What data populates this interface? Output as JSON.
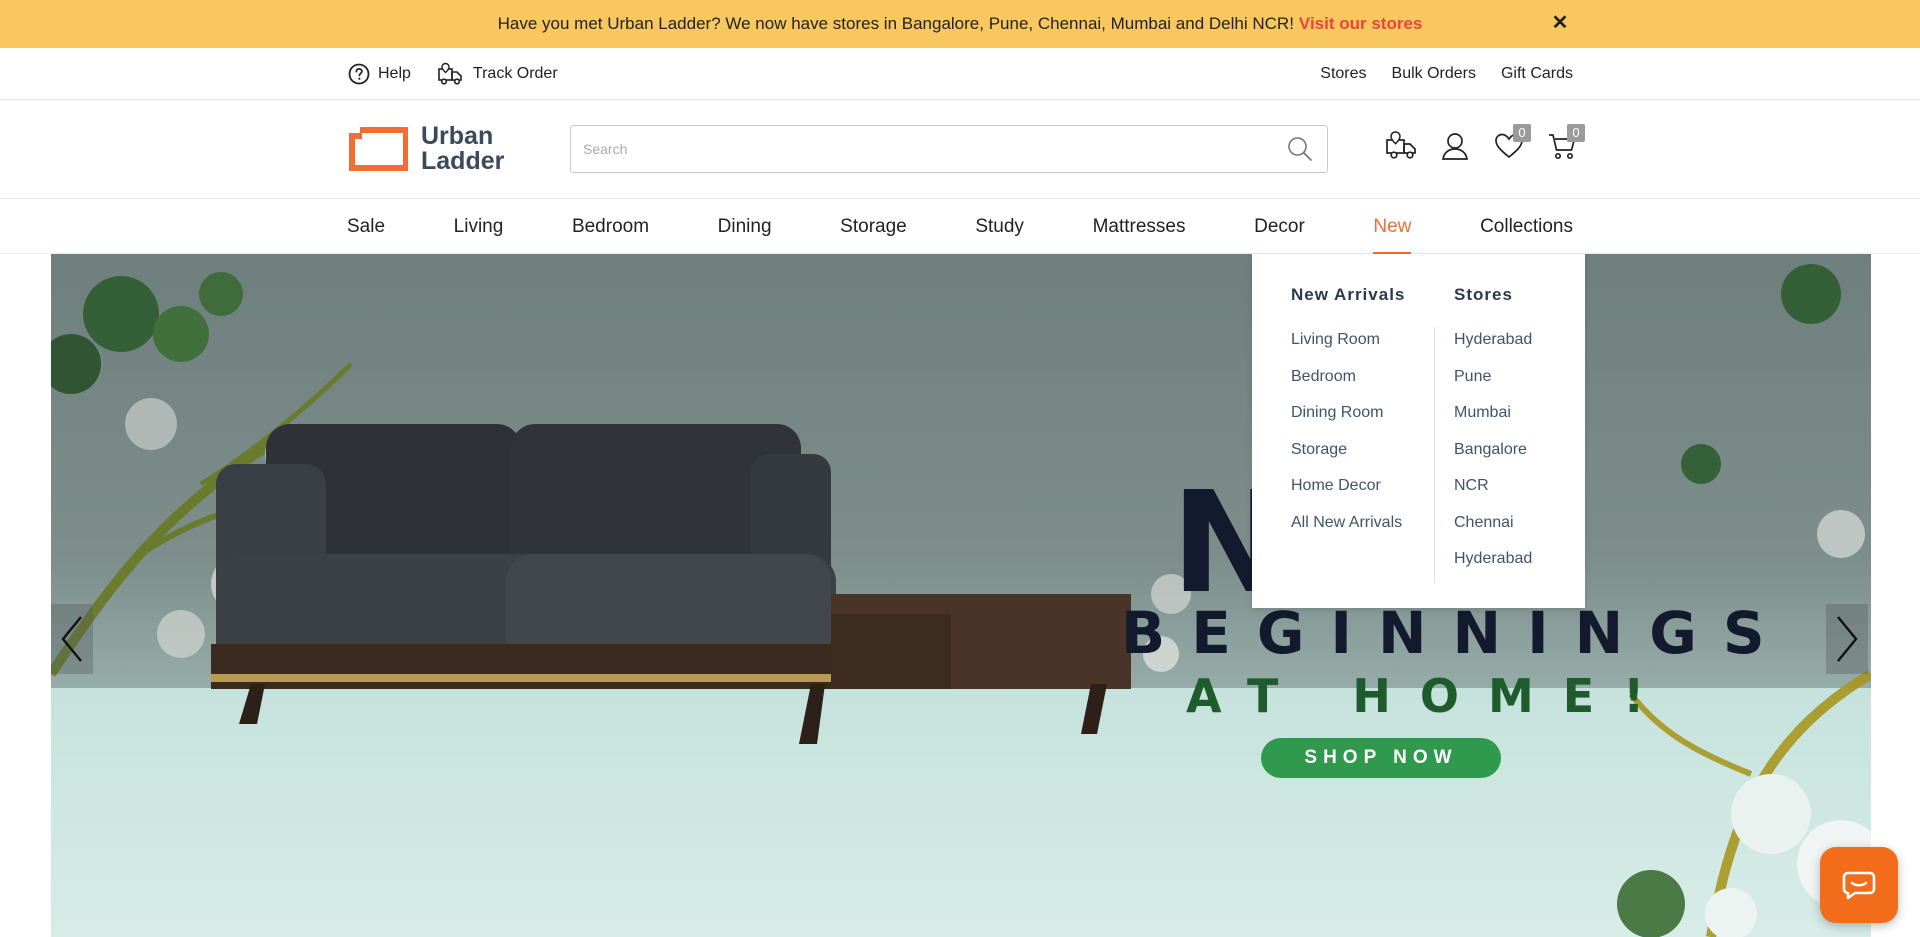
{
  "announcement": {
    "text": "Have you met Urban Ladder? We now have stores in Bangalore, Pune, Chennai, Mumbai and Delhi NCR!",
    "link": "Visit our stores",
    "close": "✕"
  },
  "utility": {
    "help": "Help",
    "track_order": "Track Order",
    "stores": "Stores",
    "bulk_orders": "Bulk Orders",
    "gift_cards": "Gift Cards"
  },
  "header": {
    "logo_line1": "Urban",
    "logo_line2": "Ladder",
    "search_placeholder": "Search",
    "wishlist_count": "0",
    "cart_count": "0"
  },
  "nav": {
    "items": [
      "Sale",
      "Living",
      "Bedroom",
      "Dining",
      "Storage",
      "Study",
      "Mattresses",
      "Decor",
      "New",
      "Collections"
    ],
    "active": "New"
  },
  "dropdown": {
    "col1_title": "New Arrivals",
    "col1_items": [
      "Living Room",
      "Bedroom",
      "Dining Room",
      "Storage",
      "Home Decor",
      "All New Arrivals"
    ],
    "col2_title": "Stores",
    "col2_items": [
      "Hyderabad",
      "Pune",
      "Mumbai",
      "Bangalore",
      "NCR",
      "Chennai",
      "Hyderabad"
    ]
  },
  "hero": {
    "line1": "N",
    "line2": "BEGINNINGS",
    "line3": "AT HOME!",
    "cta": "SHOP NOW"
  },
  "colors": {
    "announcement_bg": "#f9c760",
    "accent": "#f36c34",
    "link_red": "#e8463a",
    "cta_green": "#2f9a4d",
    "chat_orange": "#f36c1c"
  },
  "icons": [
    "help-icon",
    "truck-icon",
    "search-icon",
    "track-order-icon",
    "user-icon",
    "heart-icon",
    "cart-icon",
    "chevron-left-icon",
    "chevron-right-icon",
    "chat-icon",
    "close-icon"
  ]
}
